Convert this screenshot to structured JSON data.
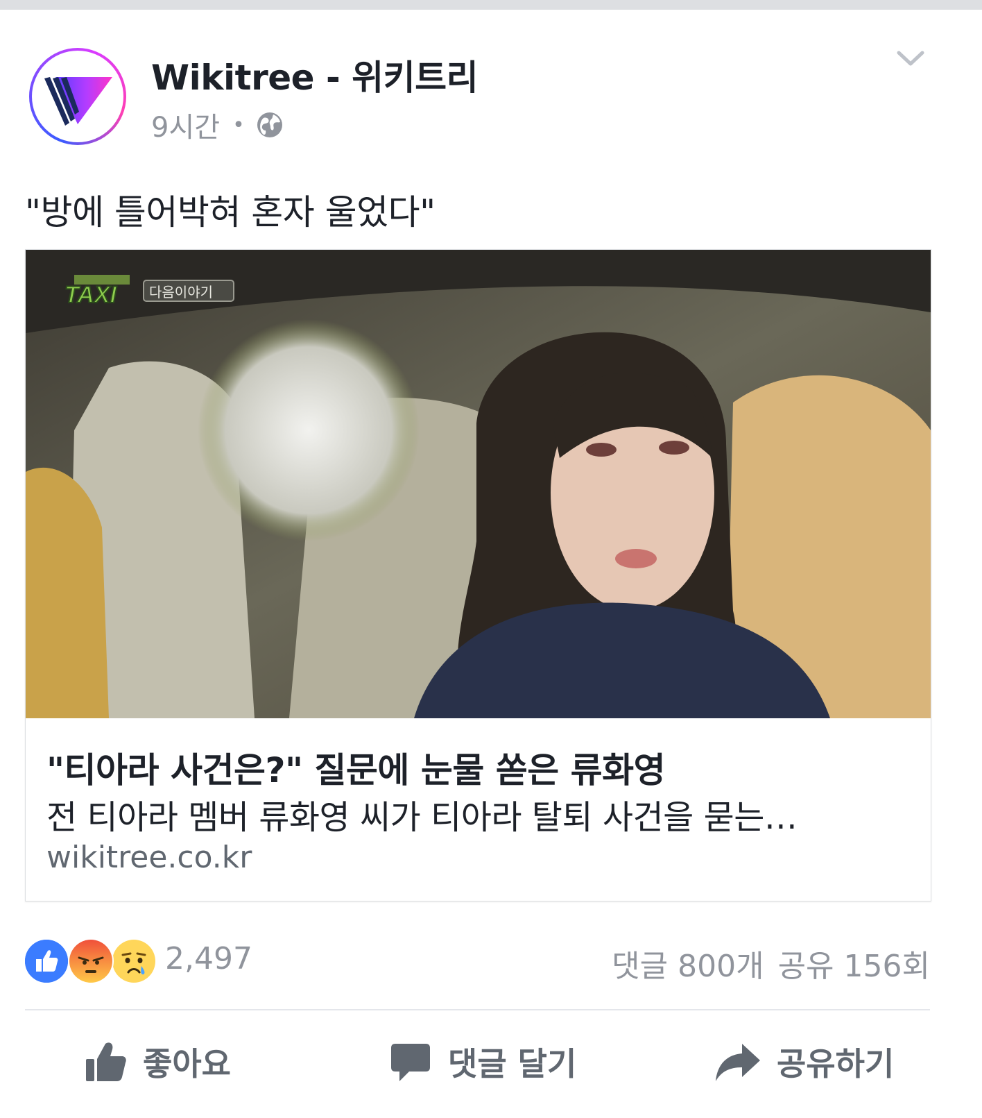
{
  "post": {
    "page_name": "Wikitree - 위키트리",
    "time": "9시간",
    "separator": "•",
    "privacy_icon": "globe-icon",
    "menu_icon": "chevron-down-icon",
    "text": "\"방에 틀어박혀 혼자 울었다\""
  },
  "link": {
    "image_overlay": {
      "show_name": "TAXI",
      "badge": "다음이야기"
    },
    "title": "\"티아라 사건은?\" 질문에 눈물 쏟은 류화영",
    "description": "전 티아라 멤버 류화영 씨가 티아라 탈퇴 사건을 묻는…",
    "domain": "wikitree.co.kr"
  },
  "engagement": {
    "reaction_icons": [
      "like-reaction-icon",
      "angry-reaction-icon",
      "sad-reaction-icon"
    ],
    "reaction_count": "2,497",
    "comments": "댓글 800개",
    "shares": "공유 156회"
  },
  "actions": {
    "like": {
      "label": "좋아요",
      "icon": "thumbs-up-icon"
    },
    "comment": {
      "label": "댓글 달기",
      "icon": "comment-bubble-icon"
    },
    "share": {
      "label": "공유하기",
      "icon": "share-arrow-icon"
    }
  },
  "colors": {
    "text_primary": "#1d2129",
    "text_secondary": "#90949c",
    "like_blue": "#3b7cff",
    "divider": "#dddfe2"
  }
}
